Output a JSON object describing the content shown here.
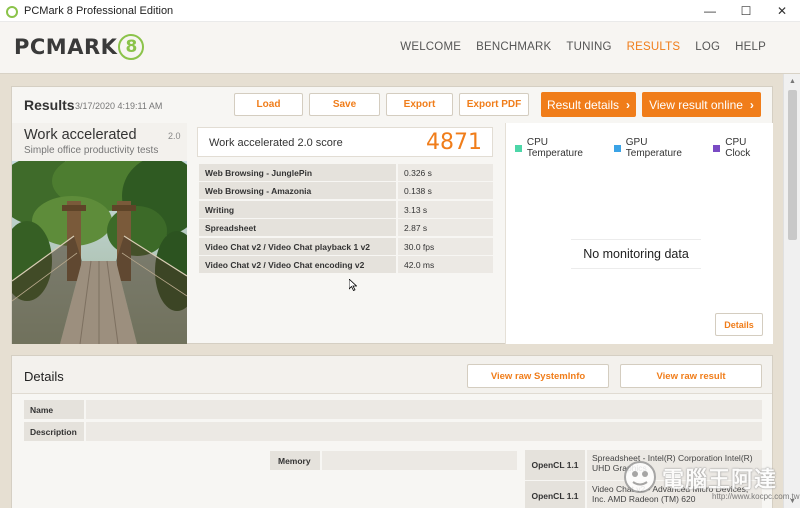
{
  "window": {
    "title": "PCMark 8 Professional Edition",
    "controls": [
      "—",
      "☐",
      "✕"
    ]
  },
  "header": {
    "logo_text": "PCMARK",
    "logo_badge": "8",
    "nav": [
      {
        "label": "WELCOME",
        "active": false
      },
      {
        "label": "BENCHMARK",
        "active": false
      },
      {
        "label": "TUNING",
        "active": false
      },
      {
        "label": "RESULTS",
        "active": true
      },
      {
        "label": "LOG",
        "active": false
      },
      {
        "label": "HELP",
        "active": false
      }
    ]
  },
  "results": {
    "title": "Results",
    "date": "3/17/2020 4:19:11 AM",
    "buttons": {
      "load": "Load",
      "save": "Save",
      "export": "Export",
      "export_pdf": "Export PDF",
      "result_details": "Result details",
      "view_online": "View result online"
    },
    "test": {
      "name": "Work accelerated",
      "version": "2.0",
      "description": "Simple office productivity tests"
    },
    "score": {
      "label": "Work accelerated 2.0 score",
      "value": "4871"
    },
    "subtests": [
      {
        "name": "Web Browsing - JunglePin",
        "value": "0.326 s"
      },
      {
        "name": "Web Browsing - Amazonia",
        "value": "0.138 s"
      },
      {
        "name": "Writing",
        "value": "3.13 s"
      },
      {
        "name": "Spreadsheet",
        "value": "2.87 s"
      },
      {
        "name": "Video Chat v2 / Video Chat playback 1 v2",
        "value": "30.0 fps"
      },
      {
        "name": "Video Chat v2 / Video Chat encoding v2",
        "value": "42.0 ms"
      }
    ],
    "monitoring": {
      "legend": [
        {
          "label": "CPU Temperature",
          "color": "#4dd6a8"
        },
        {
          "label": "GPU Temperature",
          "color": "#3ba3e6"
        },
        {
          "label": "CPU Clock",
          "color": "#7a4bc4"
        }
      ],
      "no_data": "No monitoring data",
      "details_button": "Details"
    }
  },
  "details": {
    "title": "Details",
    "view_systeminfo": "View raw SystemInfo",
    "view_raw_result": "View raw result",
    "name_label": "Name",
    "description_label": "Description",
    "memory_label": "Memory",
    "opencl": [
      {
        "label": "OpenCL 1.1",
        "value": "Spreadsheet - Intel(R) Corporation Intel(R) UHD Graphics"
      },
      {
        "label": "OpenCL 1.1",
        "value": "Video Chat v2 - Advanced Micro Devices, Inc. AMD Radeon (TM) 620"
      }
    ]
  },
  "watermark": {
    "text": "電腦王阿達",
    "url": "http://www.kocpc.com.tw"
  },
  "colors": {
    "accent": "#f07d1a",
    "brand_green": "#8bc34a"
  }
}
